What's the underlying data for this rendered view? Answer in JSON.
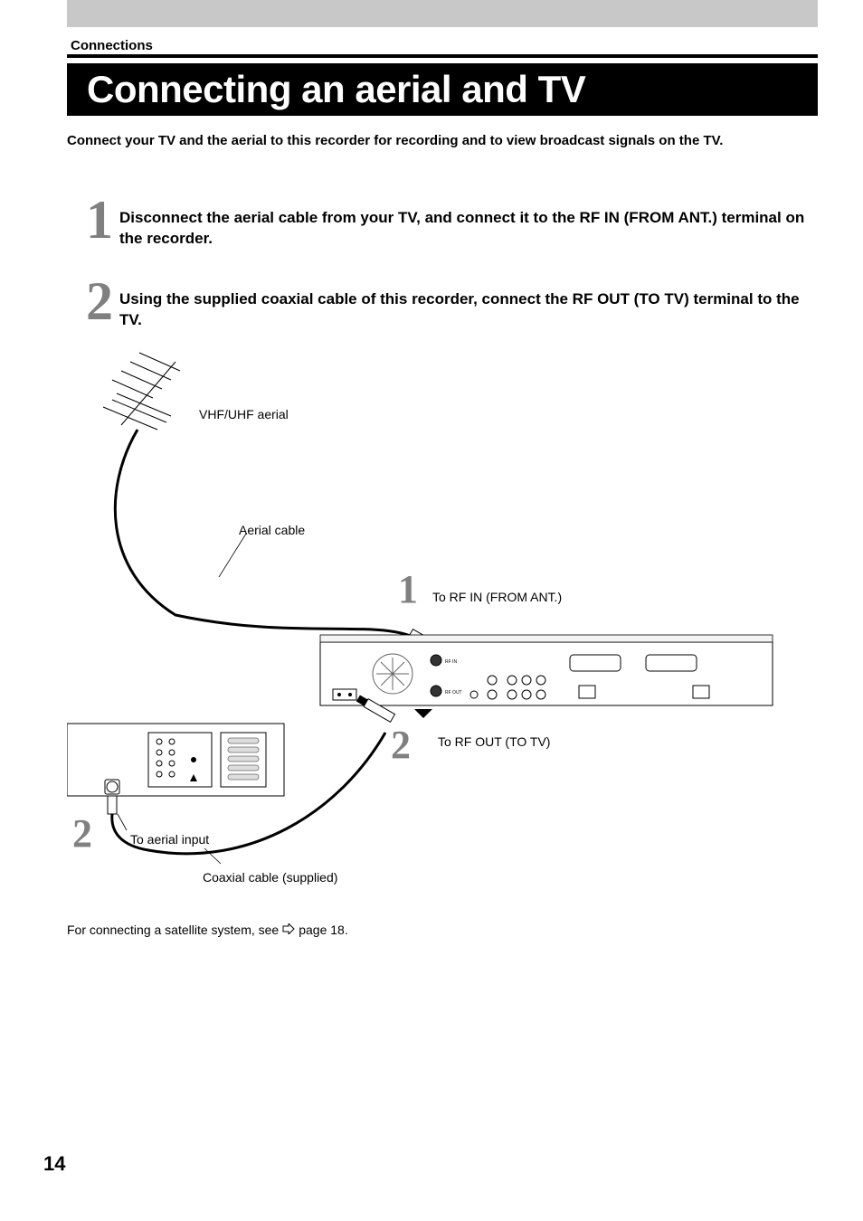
{
  "header": {
    "section": "Connections",
    "title": "Connecting an aerial and TV"
  },
  "intro": "Connect your TV and the aerial to this recorder for recording and to view broadcast signals on the TV.",
  "steps": [
    {
      "num": "1",
      "text": "Disconnect the aerial cable from your TV, and connect it to the RF IN (FROM ANT.) terminal on the recorder."
    },
    {
      "num": "2",
      "text": "Using the supplied coaxial cable of this recorder, connect the RF OUT (TO TV) terminal to the TV."
    }
  ],
  "diagram": {
    "aerial": "VHF/UHF aerial",
    "aerial_cable": "Aerial cable",
    "rf_in_num": "1",
    "rf_in": "To RF IN (FROM ANT.)",
    "rf_out_num": "2",
    "rf_out": "To RF OUT (TO TV)",
    "tv_num": "2",
    "tv": "To aerial input",
    "coax": "Coaxial cable (supplied)"
  },
  "footnote": {
    "before": "For connecting a satellite system, see",
    "after": "page 18."
  },
  "page_number": "14"
}
